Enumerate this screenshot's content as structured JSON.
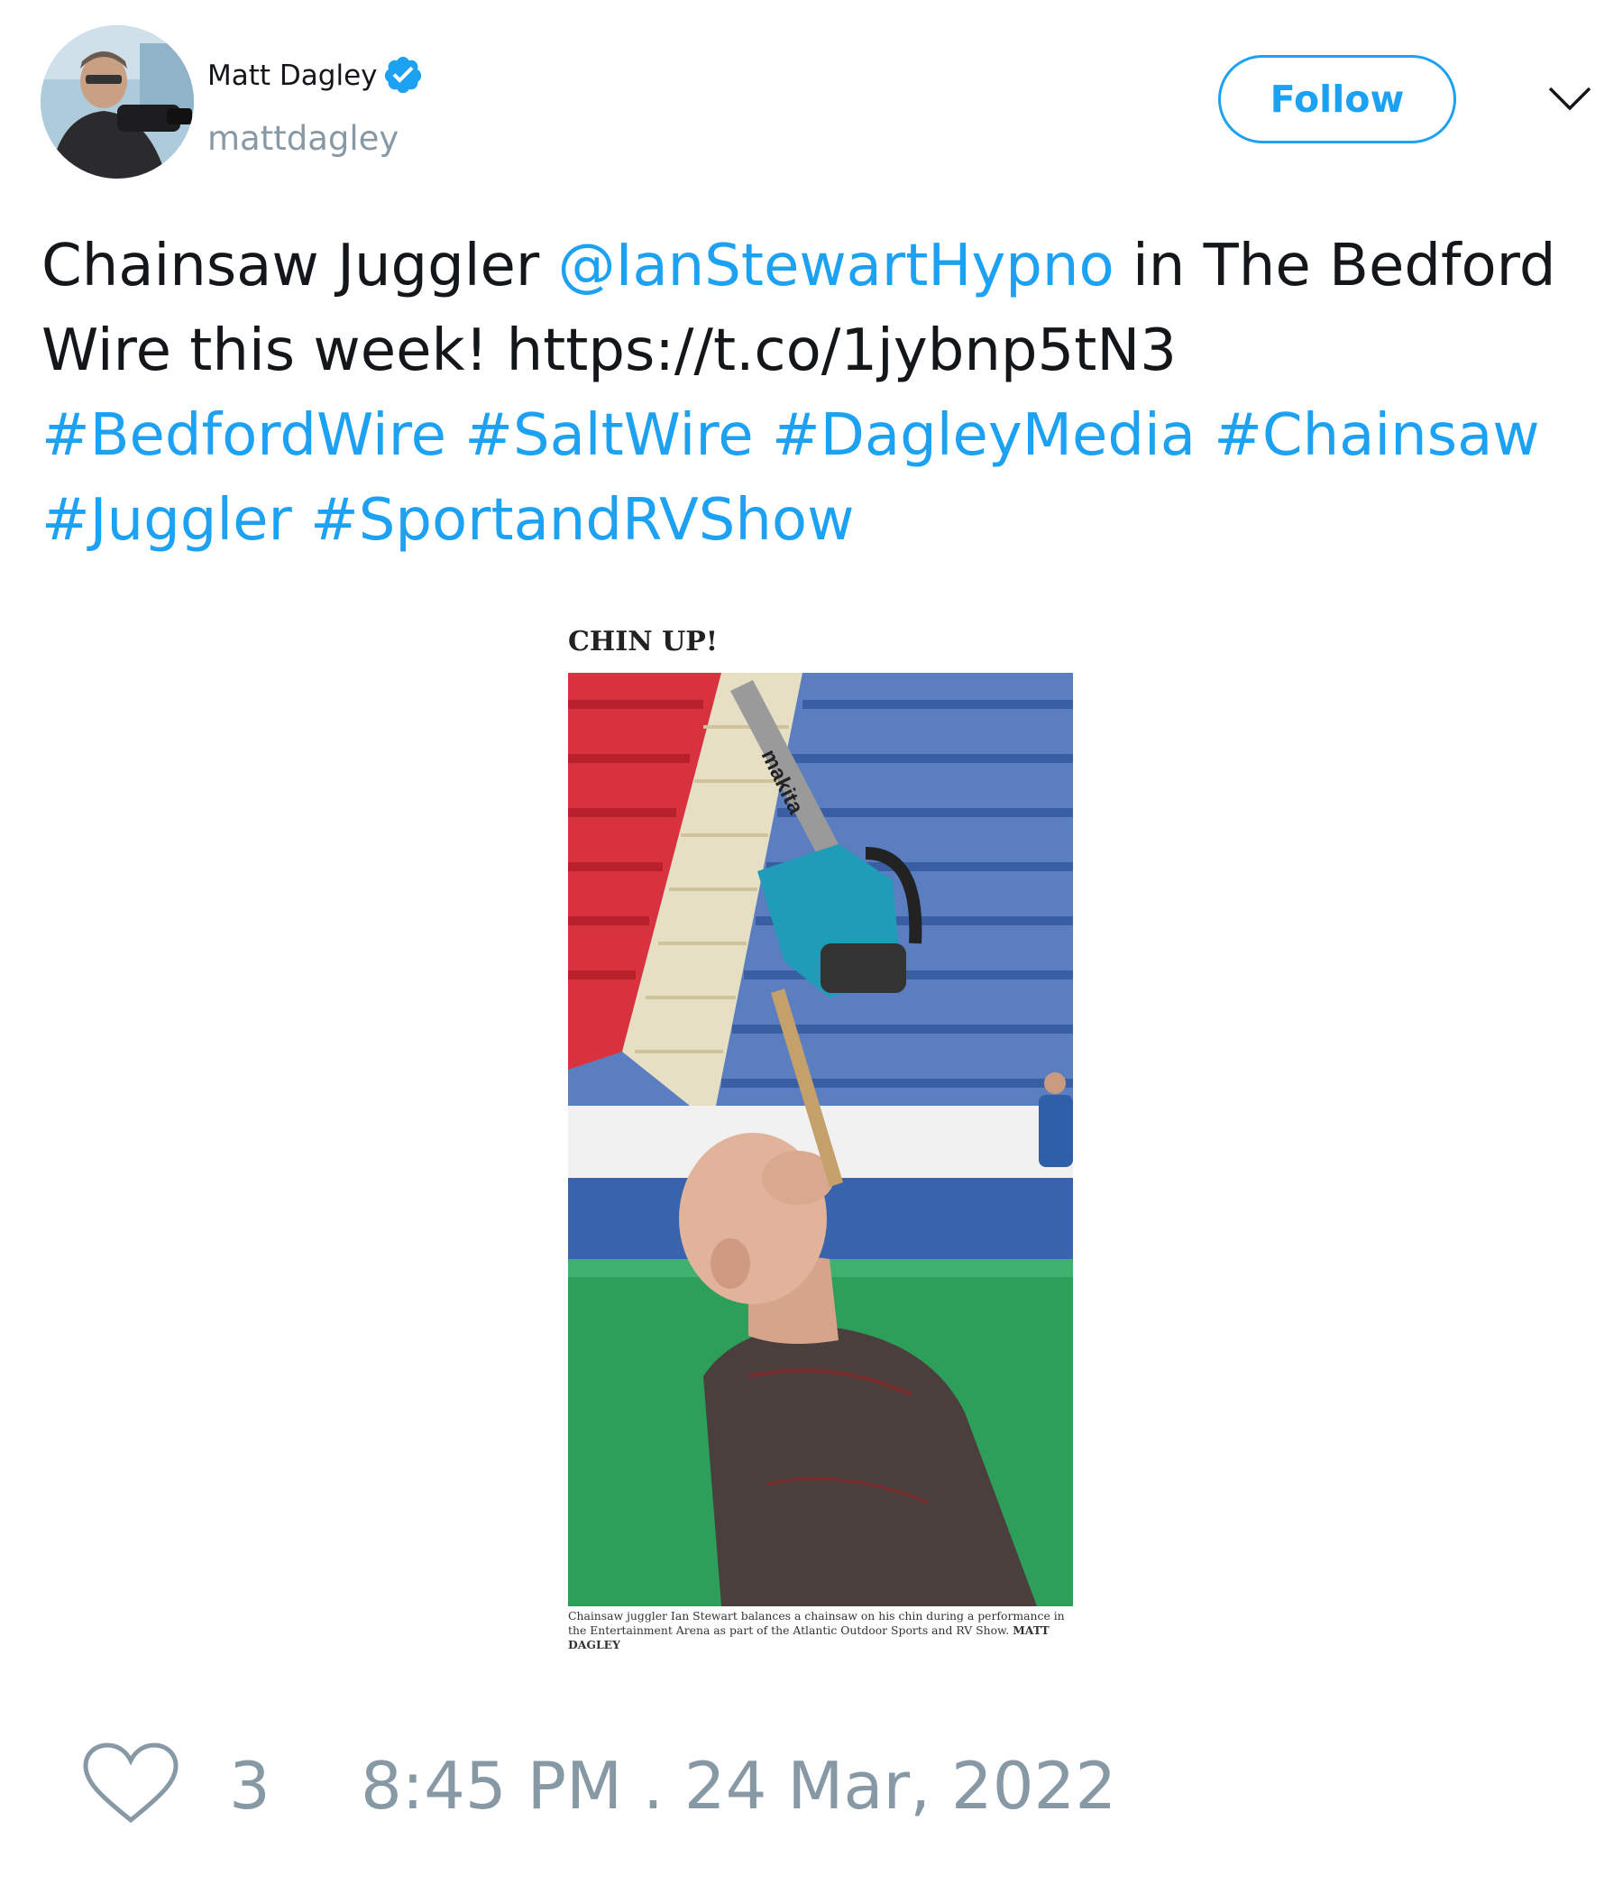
{
  "author": {
    "display_name": "Matt Dagley",
    "handle": "mattdagley",
    "verified": true,
    "avatar_icon": "profile-photo"
  },
  "actions": {
    "follow_label": "Follow",
    "menu_icon": "chevron-down-icon"
  },
  "tweet": {
    "segments": [
      {
        "text": "Chainsaw Juggler ",
        "link": false
      },
      {
        "text": "@IanStewartHypno",
        "link": true
      },
      {
        "text": " in The Bedford Wire this week! https://t.co/1jybnp5tN3 ",
        "link": false
      },
      {
        "text": "#BedfordWire",
        "link": true
      },
      {
        "text": " ",
        "link": false
      },
      {
        "text": "#SaltWire",
        "link": true
      },
      {
        "text": " ",
        "link": false
      },
      {
        "text": "#DagleyMedia",
        "link": true
      },
      {
        "text": " ",
        "link": false
      },
      {
        "text": "#Chainsaw",
        "link": true
      },
      {
        "text": " ",
        "link": false
      },
      {
        "text": "#Juggler",
        "link": true
      },
      {
        "text": " ",
        "link": false
      },
      {
        "text": "#SportandRVShow",
        "link": true
      }
    ]
  },
  "media": {
    "headline": "CHIN UP!",
    "chainsaw_brand": "makita",
    "caption": "Chainsaw juggler Ian Stewart balances a chainsaw on his chin during a performance in the Entertainment Arena as part of the Atlantic Outdoor Sports and RV Show.",
    "credit": "MATT DAGLEY"
  },
  "footer": {
    "like_icon": "heart-icon",
    "like_count": "3",
    "timestamp": "8:45 PM . 24 Mar, 2022"
  },
  "colors": {
    "link": "#1da1f2",
    "muted": "#8899a6",
    "text": "#14171a"
  }
}
